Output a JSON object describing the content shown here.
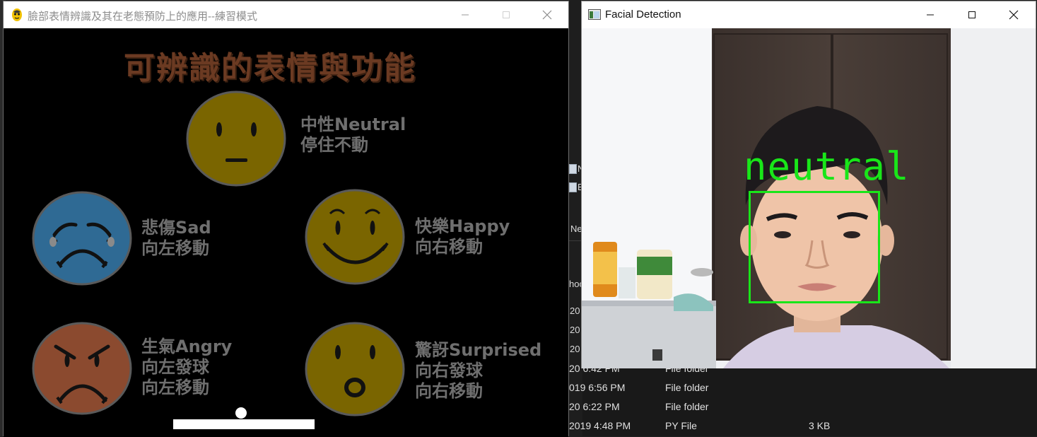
{
  "explorer": {
    "rows": [
      {
        "date": "20 6:42 PM",
        "type": "File folder",
        "size": ""
      },
      {
        "date": "019 6:56 PM",
        "type": "File folder",
        "size": ""
      },
      {
        "date": "20 6:22 PM",
        "type": "File folder",
        "size": ""
      },
      {
        "date": "2019 4:48 PM",
        "type": "PY File",
        "size": "3 KB"
      }
    ],
    "fragments": {
      "item_n": "N",
      "item_e": "E",
      "ne": "Ne",
      "hoo": "hoo",
      "y1": "20",
      "y2": "20",
      "y3": "20"
    }
  },
  "game_window": {
    "title": "臉部表情辨識及其在老態預防上的應用--練習模式",
    "heading": "可辨識的表情與功能",
    "emotions": [
      {
        "name": "中性Neutral",
        "lines": [
          "中性Neutral",
          "停住不動"
        ],
        "color": "#7a6500"
      },
      {
        "name": "悲傷Sad",
        "lines": [
          "悲傷Sad",
          "向左移動"
        ],
        "color": "#2f6a94"
      },
      {
        "name": "快樂Happy",
        "lines": [
          "快樂Happy",
          "向右移動"
        ],
        "color": "#7a6500"
      },
      {
        "name": "生氣Angry",
        "lines": [
          "生氣Angry",
          "向左發球",
          "向左移動"
        ],
        "color": "#8b4a2f"
      },
      {
        "name": "驚訝Surprised",
        "lines": [
          "驚訝Surprised",
          "向右發球",
          "向右移動"
        ],
        "color": "#7a6500"
      }
    ]
  },
  "camera_window": {
    "title": "Facial Detection",
    "detected_label": "neutral",
    "box_color": "#19e619"
  },
  "icons": {
    "game_app": "pygame-snake-icon",
    "camera_app": "opencv-window-icon",
    "minimize": "minimize-icon",
    "maximize": "maximize-icon",
    "close": "close-icon"
  }
}
